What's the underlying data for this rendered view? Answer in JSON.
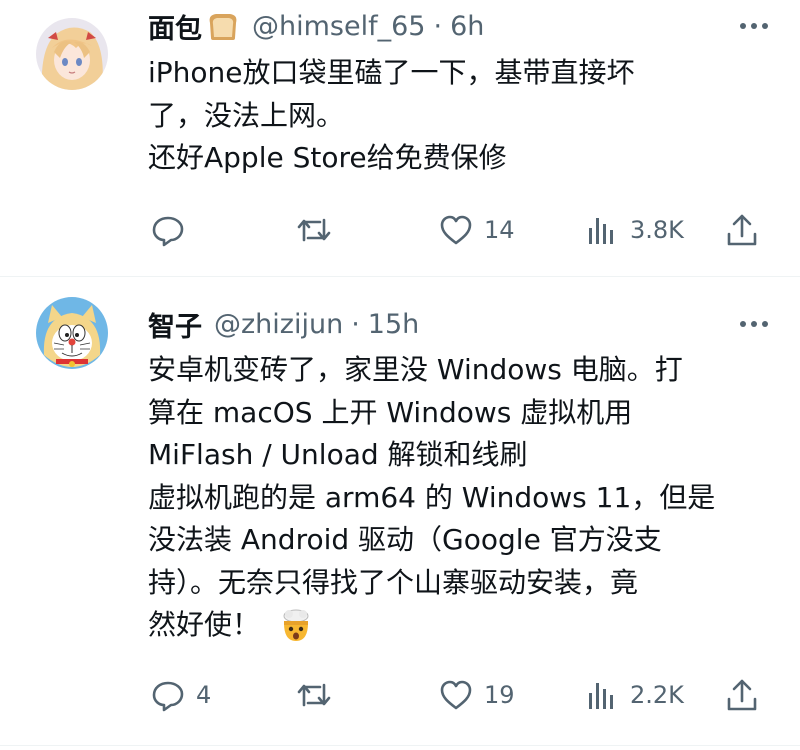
{
  "tweets": [
    {
      "name": "面包",
      "name_emoji": "bread-emoji",
      "handle": "@himself_65",
      "separator": "·",
      "time": "6h",
      "lines": [
        "iPhone放口袋里磕了一下，基带直接坏",
        "了，没法上网。",
        "还好Apple Store给免费保修"
      ],
      "reply_count": "",
      "retweet_count": "",
      "like_count": "14",
      "view_count": "3.8K"
    },
    {
      "name": "智子",
      "handle": "@zhizijun",
      "separator": "·",
      "time": "15h",
      "lines": [
        "安卓机变砖了，家里没 Windows 电脑。打",
        "算在 macOS 上开 Windows 虚拟机用",
        "MiFlash / Unload 解锁和线刷",
        "虚拟机跑的是 arm64 的 Windows 11，但是",
        "没法装 Android 驱动（Google 官方没支",
        "持）。无奈只得找了个山寨驱动安装，竟",
        "然好使！"
      ],
      "end_emoji": "exploding-head-emoji",
      "reply_count": "4",
      "retweet_count": "",
      "like_count": "19",
      "view_count": "2.2K"
    }
  ],
  "colors": {
    "text": "#0f1419",
    "secondary": "#536471",
    "divider": "#eff3f4"
  }
}
